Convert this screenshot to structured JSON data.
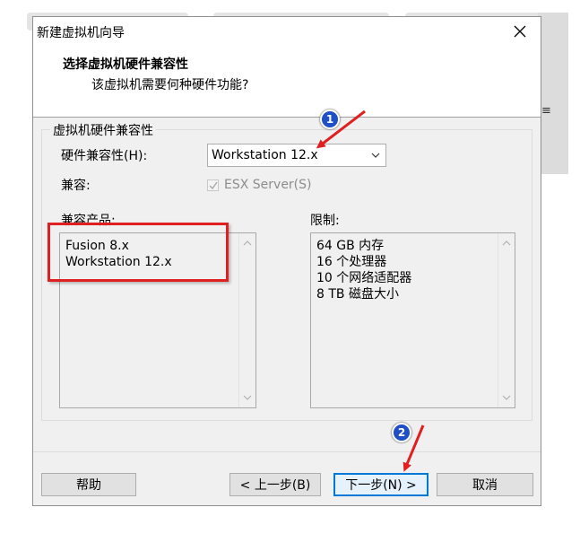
{
  "dialog": {
    "title": "新建虚拟机向导",
    "header": {
      "title": "选择虚拟机硬件兼容性",
      "subtitle": "该虚拟机需要何种硬件功能?"
    },
    "group_label": "虚拟机硬件兼容性",
    "hardware_compat": {
      "label": "硬件兼容性(H):",
      "value": "Workstation 12.x"
    },
    "compat": {
      "label": "兼容:",
      "checkbox_label": "ESX Server(S)",
      "checked": true,
      "enabled": false
    },
    "compatible_products": {
      "label": "兼容产品:",
      "items": [
        "Fusion 8.x",
        "Workstation 12.x"
      ]
    },
    "limits": {
      "label": "限制:",
      "items": [
        "64 GB 内存",
        "16 个处理器",
        "10 个网络适配器",
        "8 TB 磁盘大小"
      ]
    },
    "buttons": {
      "help": "帮助",
      "back": "< 上一步(B)",
      "next": "下一步(N) >",
      "cancel": "取消"
    }
  },
  "annotations": {
    "badges": [
      "1",
      "2"
    ],
    "color": "#e02020",
    "badge_color": "#1e4fc8"
  },
  "icons": {
    "close": "close-icon",
    "dropdown": "chevron-down-icon",
    "check": "checkmark-icon",
    "scroll_up": "scroll-up-arrow-icon",
    "scroll_down": "scroll-down-arrow-icon"
  },
  "background": {
    "edge_text": "≡"
  }
}
